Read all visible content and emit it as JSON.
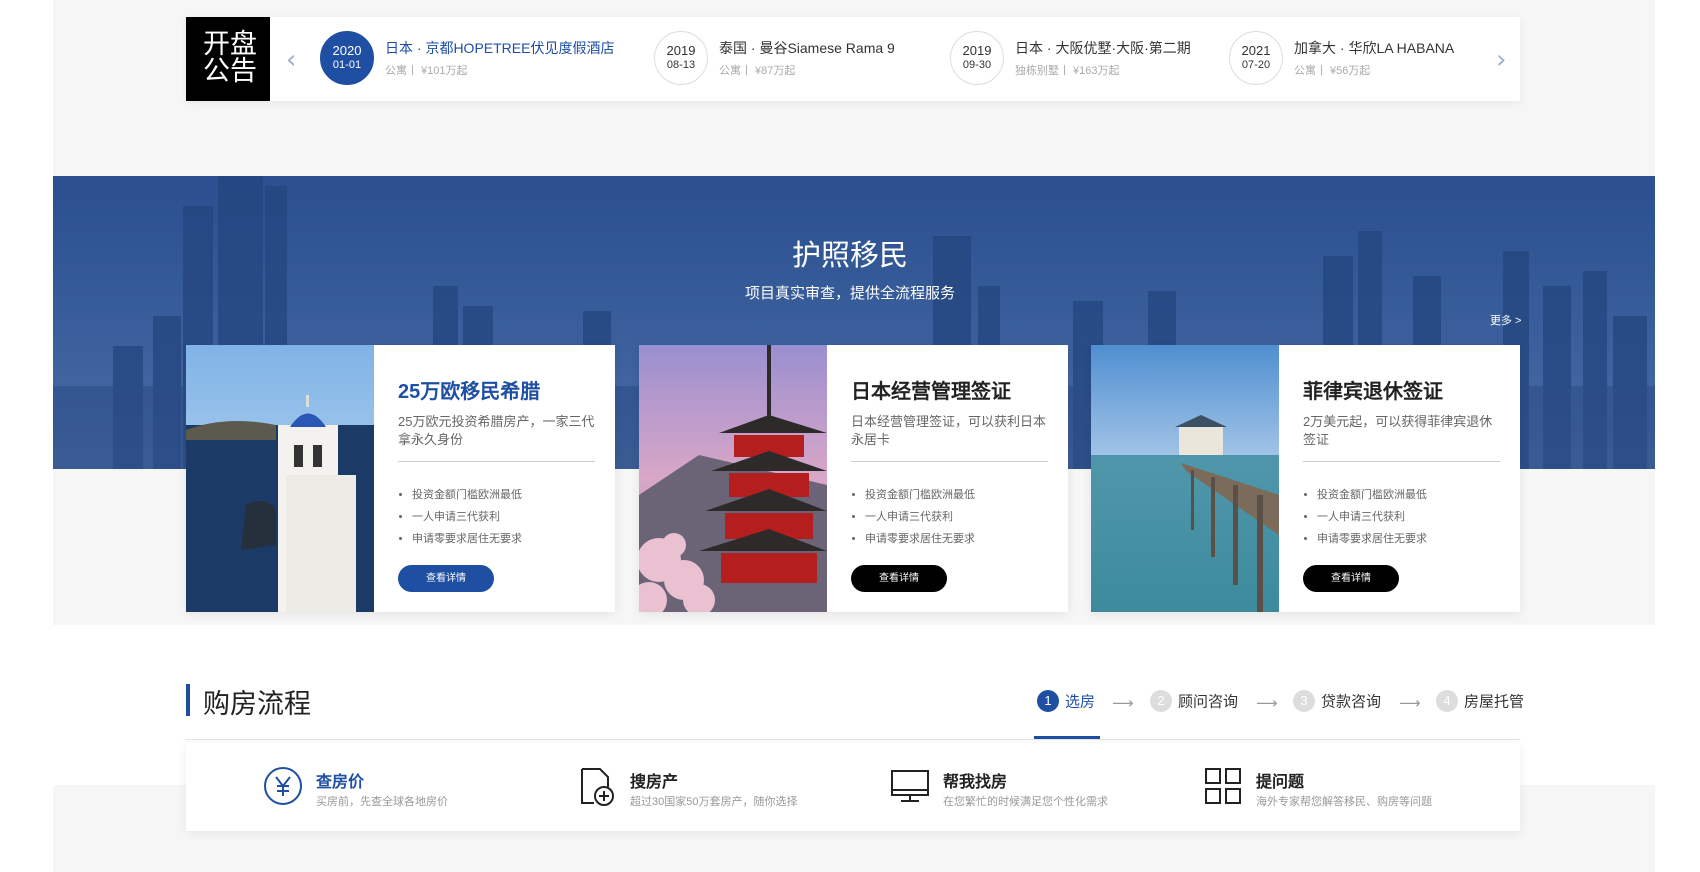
{
  "announcement": {
    "logo_lines": [
      "开盘",
      "公告"
    ],
    "items": [
      {
        "year": "2020",
        "date": "01-01",
        "title": "日本 · 京都HOPETREE伏见度假酒店",
        "meta": "公寓丨 ¥101万起"
      },
      {
        "year": "2019",
        "date": "08-13",
        "title": "泰国 · 曼谷Siamese Rama 9",
        "meta": "公寓丨 ¥87万起"
      },
      {
        "year": "2019",
        "date": "09-30",
        "title": "日本 · 大阪优墅·大阪·第二期",
        "meta": "独栋别墅丨 ¥163万起"
      },
      {
        "year": "2021",
        "date": "07-20",
        "title": "加拿大 · 华欣LA HABANA",
        "meta": "公寓丨 ¥56万起"
      }
    ],
    "prev_icon": "chevron-left-icon",
    "next_icon": "chevron-right-icon"
  },
  "immigration": {
    "title": "护照移民",
    "subtitle": "项目真实审查，提供全流程服务",
    "more": "更多 >",
    "cards": [
      {
        "title": "25万欧移民希腊",
        "desc": "25万欧元投资希腊房产，一家三代拿永久身份",
        "bullets": [
          "投资金额门槛欧洲最低",
          "一人申请三代获利",
          "申请零要求居住无要求"
        ],
        "button": "查看详情"
      },
      {
        "title": "日本经营管理签证",
        "desc": "日本经营管理签证，可以获利日本永居卡",
        "bullets": [
          "投资金额门槛欧洲最低",
          "一人申请三代获利",
          "申请零要求居住无要求"
        ],
        "button": "查看详情"
      },
      {
        "title": "菲律宾退休签证",
        "desc": "2万美元起，可以获得菲律宾退休签证",
        "bullets": [
          "投资金额门槛欧洲最低",
          "一人申请三代获利",
          "申请零要求居住无要求"
        ],
        "button": "查看详情"
      }
    ]
  },
  "process": {
    "title": "购房流程",
    "steps": [
      {
        "num": "1",
        "label": "选房"
      },
      {
        "num": "2",
        "label": "顾问咨询"
      },
      {
        "num": "3",
        "label": "贷款咨询"
      },
      {
        "num": "4",
        "label": "房屋托管"
      }
    ],
    "features": [
      {
        "icon": "yen-icon",
        "title": "查房价",
        "sub": "买房前，先查全球各地房价"
      },
      {
        "icon": "add-document-icon",
        "title": "搜房产",
        "sub": "超过30国家50万套房产，随你选择"
      },
      {
        "icon": "monitor-icon",
        "title": "帮我找房",
        "sub": "在您繁忙的时候满足您个性化需求"
      },
      {
        "icon": "grid-icon",
        "title": "提问题",
        "sub": "海外专家帮您解答移民、购房等问题"
      }
    ]
  },
  "colors": {
    "accent": "#1e4fa3",
    "banner": "#2b4f8f",
    "dark_button": "#000000"
  }
}
